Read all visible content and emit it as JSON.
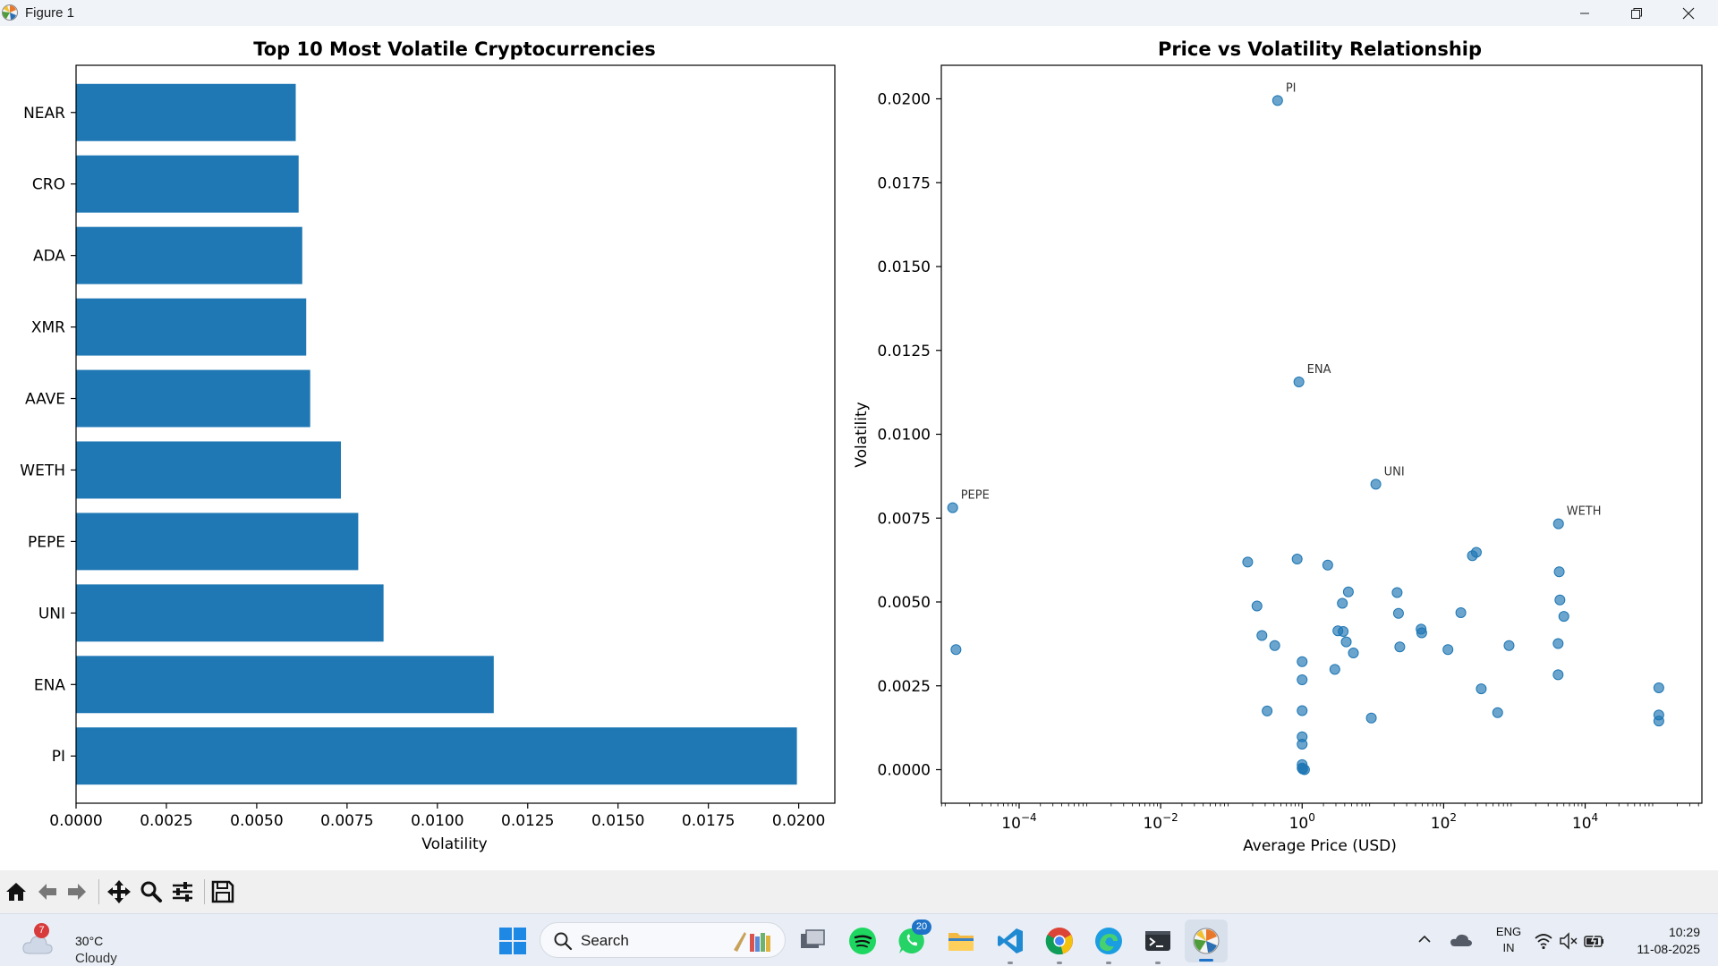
{
  "window": {
    "title": "Figure 1"
  },
  "chart_data": [
    {
      "type": "bar",
      "orientation": "horizontal",
      "title": "Top 10 Most Volatile Cryptocurrencies",
      "xlabel": "Volatility",
      "ylabel": "",
      "xlim": [
        0,
        0.021
      ],
      "xticks": [
        0,
        0.0025,
        0.005,
        0.0075,
        0.01,
        0.0125,
        0.015,
        0.0175,
        0.02
      ],
      "xtick_labels": [
        "0.0000",
        "0.0025",
        "0.0050",
        "0.0075",
        "0.0100",
        "0.0125",
        "0.0150",
        "0.0175",
        "0.0200"
      ],
      "categories": [
        "PI",
        "ENA",
        "UNI",
        "PEPE",
        "WETH",
        "AAVE",
        "XMR",
        "ADA",
        "CRO",
        "NEAR"
      ],
      "values": [
        0.01995,
        0.01156,
        0.00851,
        0.00781,
        0.00733,
        0.00648,
        0.00637,
        0.00626,
        0.00616,
        0.00608
      ],
      "color": "#1f77b4"
    },
    {
      "type": "scatter",
      "title": "Price vs Volatility Relationship",
      "xlabel": "Average Price (USD)",
      "ylabel": "Volatility",
      "x_scale": "log",
      "xticks": [
        0.0001,
        0.01,
        1,
        100,
        10000
      ],
      "xtick_labels": [
        [
          "10",
          "−4"
        ],
        [
          "10",
          "−2"
        ],
        [
          "10",
          "0"
        ],
        [
          "10",
          "2"
        ],
        [
          "10",
          "4"
        ]
      ],
      "ylim": [
        -0.001,
        0.021
      ],
      "yticks": [
        0,
        0.0025,
        0.005,
        0.0075,
        0.01,
        0.0125,
        0.015,
        0.0175,
        0.02
      ],
      "ytick_labels": [
        "0.0000",
        "0.0025",
        "0.0050",
        "0.0075",
        "0.0100",
        "0.0125",
        "0.0150",
        "0.0175",
        "0.0200"
      ],
      "color": "#1f77b4",
      "annotations": [
        {
          "label": "PI",
          "x": 0.45,
          "y": 0.01995
        },
        {
          "label": "ENA",
          "x": 0.9,
          "y": 0.01156
        },
        {
          "label": "UNI",
          "x": 11,
          "y": 0.00851
        },
        {
          "label": "PEPE",
          "x": 1.15e-05,
          "y": 0.00781
        },
        {
          "label": "WETH",
          "x": 4200,
          "y": 0.00733
        }
      ],
      "points": [
        [
          0.45,
          0.01995
        ],
        [
          0.9,
          0.01156
        ],
        [
          11,
          0.00851
        ],
        [
          1.15e-05,
          0.00781
        ],
        [
          4200,
          0.00733
        ],
        [
          1.28e-05,
          0.00358
        ],
        [
          0.17,
          0.00619
        ],
        [
          0.85,
          0.00628
        ],
        [
          2.3,
          0.0061
        ],
        [
          0.23,
          0.00488
        ],
        [
          0.27,
          0.004
        ],
        [
          0.41,
          0.0037
        ],
        [
          0.32,
          0.00175
        ],
        [
          1.0,
          0.00322
        ],
        [
          1.0,
          0.00268
        ],
        [
          1.0,
          0.00176
        ],
        [
          1.0,
          0.00098
        ],
        [
          1.0,
          0.00076
        ],
        [
          1.0,
          0.00015
        ],
        [
          1.0,
          5e-05
        ],
        [
          1.02,
          2e-05
        ],
        [
          1.08,
          0.0
        ],
        [
          3.2,
          0.00414
        ],
        [
          3.8,
          0.00412
        ],
        [
          3.7,
          0.00496
        ],
        [
          4.5,
          0.0053
        ],
        [
          4.2,
          0.00381
        ],
        [
          5.3,
          0.00348
        ],
        [
          2.9,
          0.00299
        ],
        [
          9.5,
          0.00154
        ],
        [
          22,
          0.00528
        ],
        [
          23,
          0.00466
        ],
        [
          24,
          0.00366
        ],
        [
          48,
          0.00419
        ],
        [
          49,
          0.00408
        ],
        [
          115,
          0.00358
        ],
        [
          175,
          0.00468
        ],
        [
          255,
          0.00638
        ],
        [
          290,
          0.00648
        ],
        [
          340,
          0.00241
        ],
        [
          580,
          0.0017
        ],
        [
          840,
          0.0037
        ],
        [
          4300,
          0.0059
        ],
        [
          4400,
          0.00506
        ],
        [
          5000,
          0.00457
        ],
        [
          4150,
          0.00376
        ],
        [
          4150,
          0.00283
        ],
        [
          110000,
          0.00244
        ],
        [
          110000,
          0.00163
        ],
        [
          110000,
          0.00145
        ]
      ]
    }
  ],
  "toolbar": {
    "buttons": [
      "home",
      "back",
      "forward",
      "pan",
      "zoom",
      "configure-subplots",
      "save"
    ]
  },
  "taskbar": {
    "weather": {
      "temp": "30°C",
      "condition": "Cloudy",
      "badge": "7"
    },
    "search": {
      "placeholder": "Search"
    },
    "whatsapp_badge": "20",
    "lang": {
      "line1": "ENG",
      "line2": "IN"
    },
    "clock": {
      "time": "10:29",
      "date": "11-08-2025"
    }
  }
}
